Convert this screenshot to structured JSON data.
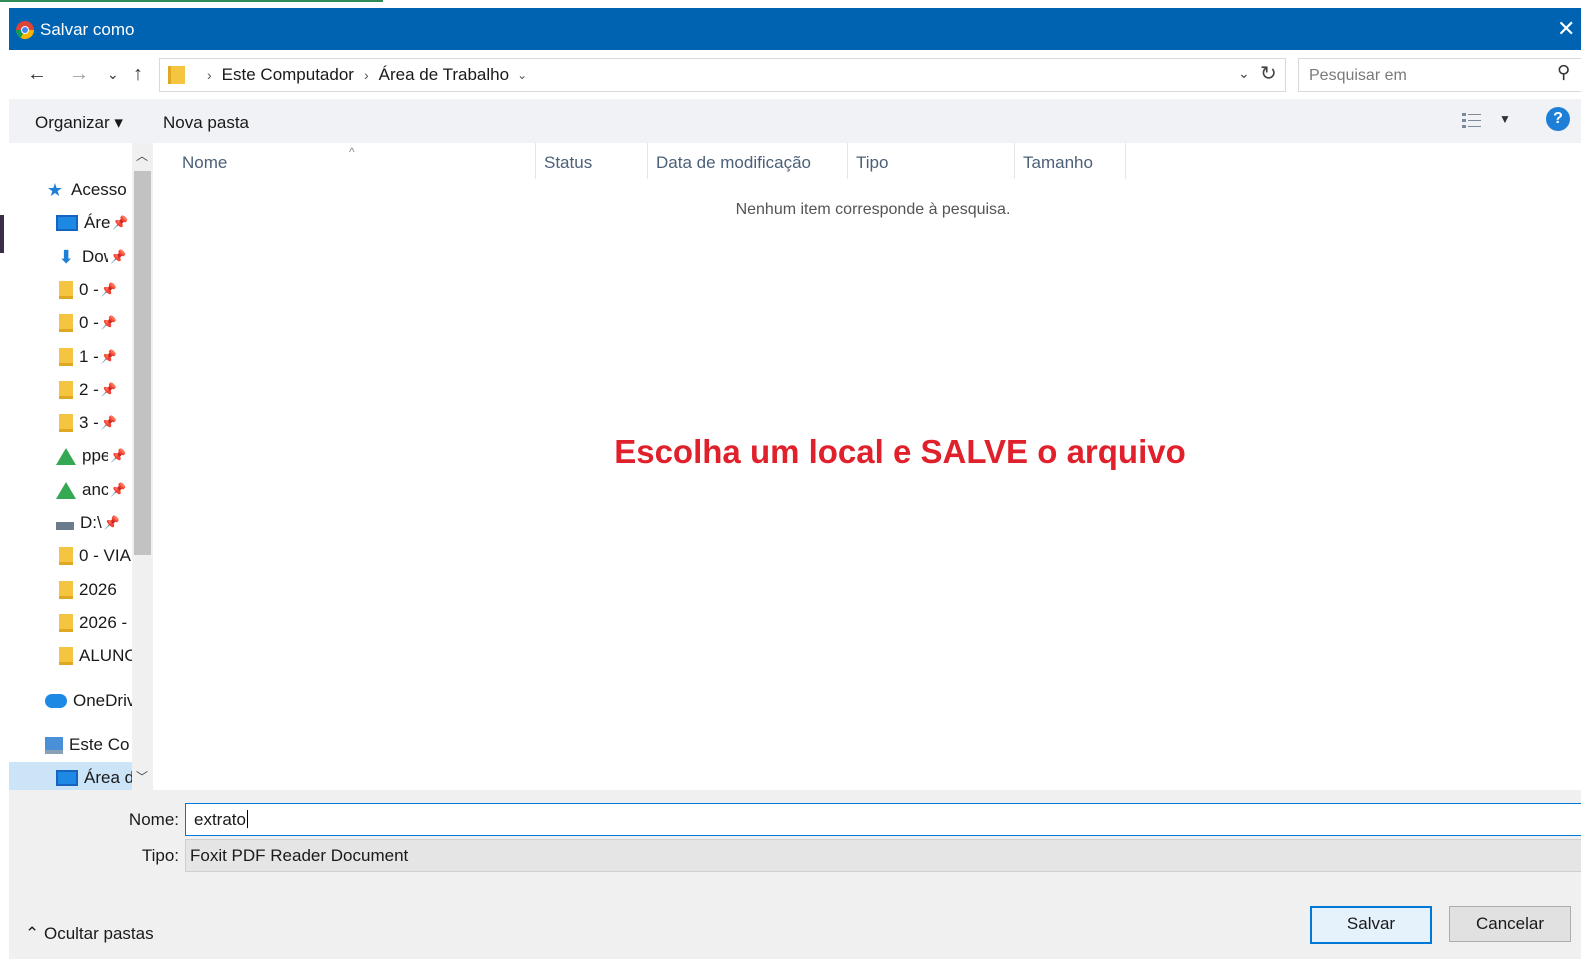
{
  "dialog": {
    "title": "Salvar como",
    "close_glyph": "✕"
  },
  "address": {
    "back_glyph": "←",
    "forward_glyph": "→",
    "recent_glyph": "⌄",
    "up_glyph": "↑",
    "crumbs": [
      "Este Computador",
      "Área de Trabalho"
    ],
    "crumb_more": "⌄",
    "dropdown_glyph": "⌄",
    "refresh_glyph": "↻",
    "search_placeholder": "Pesquisar em",
    "search_glyph": "⚲"
  },
  "toolbar": {
    "organize": "Organizar ▾",
    "new_folder": "Nova pasta",
    "view_dd": "▼",
    "help": "?"
  },
  "nav": {
    "scroll_up": "︿",
    "scroll_down": "﹀",
    "pin_glyph": "📌",
    "items": [
      {
        "label": "Acesso rápido",
        "icon": "star-icon",
        "pinned": false,
        "indent": 1
      },
      {
        "label": "Área de Trabalho",
        "icon": "desktop-icon",
        "pinned": true,
        "indent": 2
      },
      {
        "label": "Downloads",
        "icon": "download-icon",
        "pinned": true,
        "indent": 2
      },
      {
        "label": "0 -",
        "icon": "folder-icon",
        "pinned": true,
        "indent": 2
      },
      {
        "label": "0 -",
        "icon": "folder-icon",
        "pinned": true,
        "indent": 2
      },
      {
        "label": "1 -",
        "icon": "folder-icon",
        "pinned": true,
        "indent": 2
      },
      {
        "label": "2 -",
        "icon": "folder-icon",
        "pinned": true,
        "indent": 2
      },
      {
        "label": "3 -",
        "icon": "folder-icon",
        "pinned": true,
        "indent": 2
      },
      {
        "label": "ppe",
        "icon": "google-drive-icon",
        "pinned": true,
        "indent": 2
      },
      {
        "label": "anc",
        "icon": "google-drive-icon",
        "pinned": true,
        "indent": 2
      },
      {
        "label": "D:\\",
        "icon": "drive-icon",
        "pinned": true,
        "indent": 2
      },
      {
        "label": "0 - VIA",
        "icon": "folder-icon",
        "pinned": false,
        "indent": 2
      },
      {
        "label": "2026",
        "icon": "folder-icon",
        "pinned": false,
        "indent": 2
      },
      {
        "label": "2026 -",
        "icon": "folder-icon",
        "pinned": false,
        "indent": 2
      },
      {
        "label": "ALUNO",
        "icon": "folder-icon",
        "pinned": false,
        "indent": 2
      },
      {
        "label": "OneDrive",
        "icon": "onedrive-icon",
        "pinned": false,
        "indent": 1
      },
      {
        "label": "Este Computador",
        "icon": "computer-icon",
        "pinned": false,
        "indent": 1
      },
      {
        "label": "Área de Trabalho",
        "icon": "desktop-icon",
        "pinned": false,
        "indent": 2,
        "selected": true
      }
    ]
  },
  "filelist": {
    "sort_glyph": "^",
    "columns": [
      "Nome",
      "Status",
      "Data de modificação",
      "Tipo",
      "Tamanho"
    ],
    "empty_message": "Nenhum item corresponde à pesquisa."
  },
  "overlay_text": "Escolha um local e SALVE o arquivo",
  "form": {
    "name_label": "Nome:",
    "name_value": "extrato",
    "type_label": "Tipo:",
    "type_value": "Foxit PDF Reader Document"
  },
  "footer": {
    "hide_folders": "⌃  Ocultar pastas",
    "save": "Salvar",
    "cancel": "Cancelar"
  },
  "colors": {
    "titlebar": "#0063b1",
    "overlay": "#e0212b",
    "accent": "#0078d7"
  }
}
